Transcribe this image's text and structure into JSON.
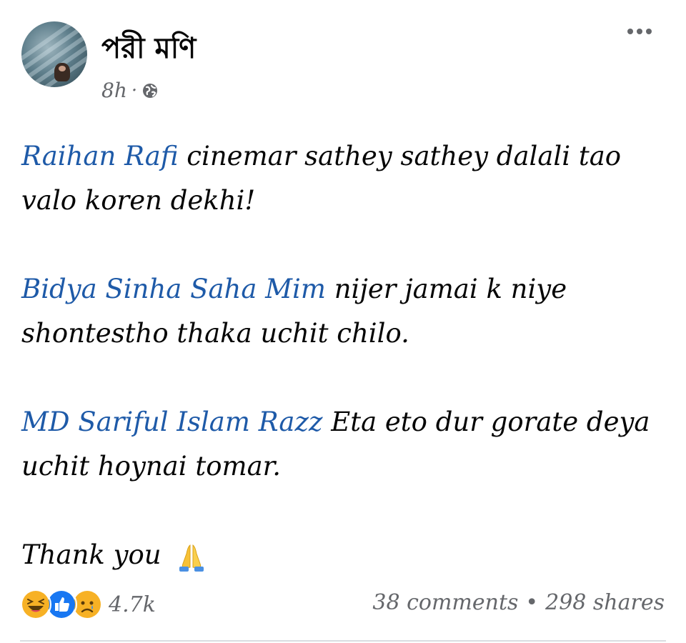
{
  "post": {
    "author": "পরী মণি",
    "time": "8h",
    "separator": "·",
    "privacy_icon": "globe-icon",
    "more_icon": "more-horizontal-icon",
    "paragraphs": [
      {
        "mention": "Raihan Rafi",
        "text": " cinemar sathey sathey dalali tao valo koren dekhi!"
      },
      {
        "mention": "Bidya Sinha Saha Mim",
        "text": " nijer jamai k niye shontestho thaka uchit chilo."
      },
      {
        "mention": "MD Sariful Islam Razz",
        "text": " Eta eto dur gorate deya uchit hoynai tomar."
      }
    ],
    "closing": "Thank you",
    "closing_emoji": "folded-hands-icon"
  },
  "footer": {
    "reaction_icons": [
      "haha-icon",
      "like-icon",
      "sad-icon"
    ],
    "reaction_count": "4.7k",
    "comments": "38 comments",
    "dot": "•",
    "shares": "298 shares"
  },
  "colors": {
    "mention": "#1e5aa8",
    "meta": "#65676b",
    "like": "#1877f2",
    "emoji_yellow": "#f7b125"
  }
}
